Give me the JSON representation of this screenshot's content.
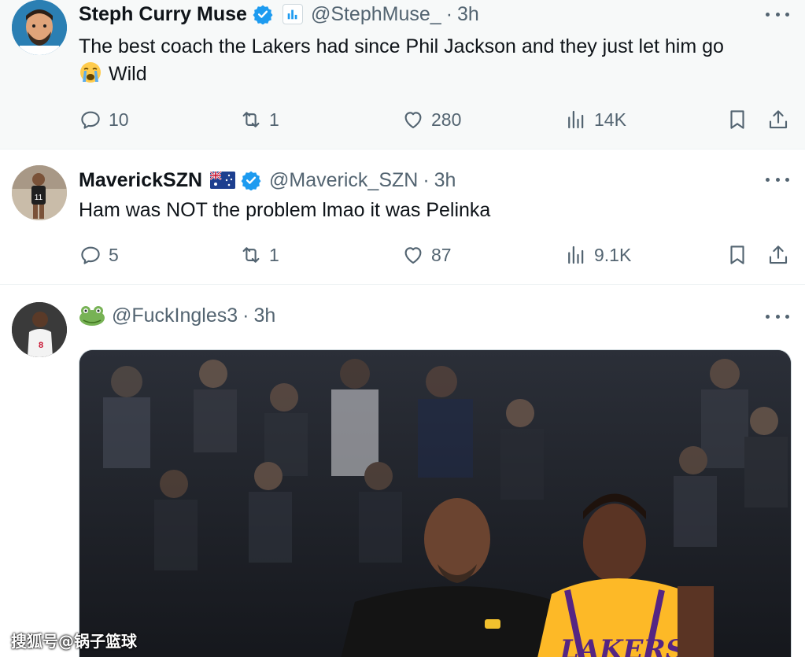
{
  "tweets": [
    {
      "display_name": "Steph Curry Muse",
      "handle": "@StephMuse_",
      "separator": "·",
      "time": "3h",
      "text": "The best coach the Lakers had since Phil Jackson and they just let him go",
      "text_line2": "Wild",
      "emoji_icon": "loudly-crying-face-icon",
      "replies": "10",
      "retweets": "1",
      "likes": "280",
      "views": "14K"
    },
    {
      "display_name": "MaverickSZN",
      "handle": "@Maverick_SZN",
      "separator": "·",
      "time": "3h",
      "flag_icon": "australia-flag-icon",
      "text": "Ham was NOT the problem lmao it was Pelinka",
      "replies": "5",
      "retweets": "1",
      "likes": "87",
      "views": "9.1K"
    },
    {
      "handle": "@FuckIngles3",
      "separator": "·",
      "time": "3h",
      "emoji_icon": "frog-icon"
    }
  ],
  "watermark": "搜狐号@锅子篮球",
  "colors": {
    "verified_blue": "#1d9bf0",
    "secondary_text": "#536471",
    "primary_text": "#0f1419",
    "highlight_bg": "#f7f9f9",
    "divider": "#eff3f4"
  }
}
